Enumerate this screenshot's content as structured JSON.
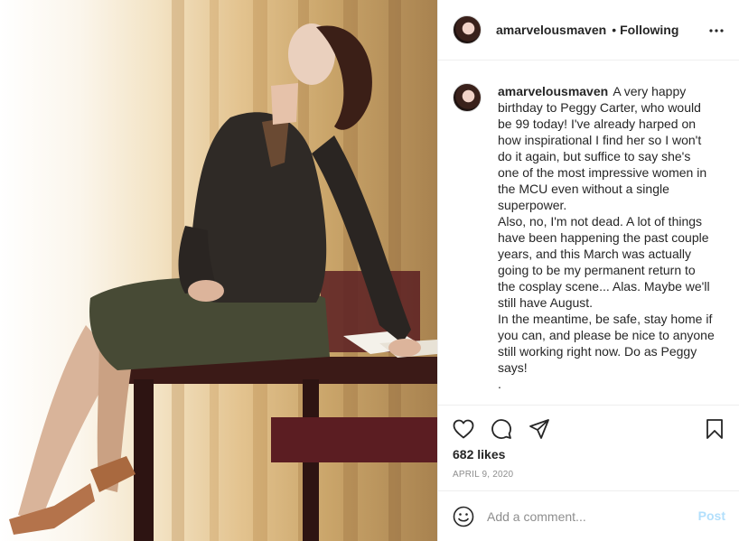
{
  "post": {
    "username": "amarvelousmaven",
    "follow_status": "Following",
    "separator": "•",
    "caption_user": "amarvelousmaven",
    "caption": "A very happy birthday to Peggy Carter, who would be 99 today! I've already harped on how inspirational I find her so I won't do it again, but suffice to say she's one of the most impressive women in the MCU even without a single superpower.\nAlso, no, I'm not dead. A lot of things have been happening the past couple years, and this March was actually going to be my permanent return to the cosplay scene... Alas. Maybe we'll still have August.\nIn the meantime, be safe, stay home if you can, and please be nice to anyone still working right now. Do as Peggy says!\n.",
    "likes": "682 likes",
    "date": "APRIL 9, 2020"
  },
  "comment": {
    "placeholder": "Add a comment...",
    "post_label": "Post"
  },
  "icons": {
    "more": "more-options-icon",
    "like": "heart-icon",
    "comment": "comment-icon",
    "share": "share-icon",
    "save": "bookmark-icon",
    "emoji": "emoji-icon"
  },
  "colors": {
    "text": "#262626",
    "muted": "#8e8e8e",
    "divider": "#efefef",
    "post_disabled": "#b2dffc"
  }
}
